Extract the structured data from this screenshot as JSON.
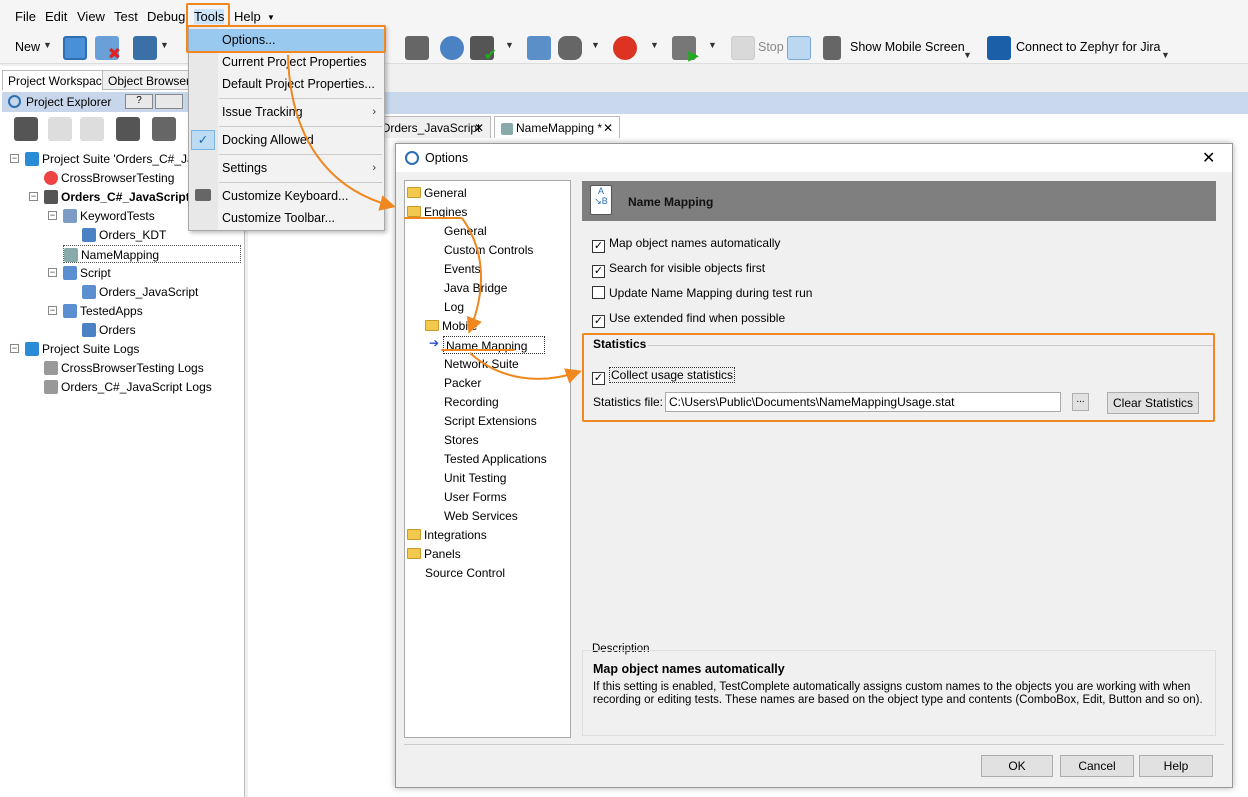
{
  "menubar": {
    "items": [
      "File",
      "Edit",
      "View",
      "Test",
      "Debug",
      "Tools",
      "Help"
    ]
  },
  "toolbar": {
    "new_label": "New",
    "stop_label": "Stop",
    "show_mobile_label": "Show Mobile Screen",
    "connect_label": "Connect to  Zephyr for Jira"
  },
  "left_panel": {
    "tabs": [
      "Project Workspace",
      "Object Browser"
    ],
    "explorer_title": "Project Explorer",
    "tree": [
      "Project Suite 'Orders_C#_Java",
      "CrossBrowserTesting",
      "Orders_C#_JavaScript",
      "KeywordTests",
      "Orders_KDT",
      "NameMapping",
      "Script",
      "Orders_JavaScript",
      "TestedApps",
      "Orders",
      "Project Suite Logs",
      "CrossBrowserTesting Logs",
      "Orders_C#_JavaScript Logs"
    ]
  },
  "doc_tabs": [
    "Orders_JavaScript",
    "NameMapping *"
  ],
  "tools_menu": {
    "items": [
      "Options...",
      "Current Project Properties",
      "Default Project Properties...",
      "Issue Tracking",
      "Docking Allowed",
      "Settings",
      "Customize Keyboard...",
      "Customize Toolbar..."
    ]
  },
  "dialog": {
    "title": "Options",
    "tree": {
      "general": "General",
      "engines": "Engines",
      "engine_children": [
        "General",
        "Custom Controls",
        "Events",
        "Java Bridge",
        "Log",
        "Mobile",
        "Name Mapping",
        "Network Suite",
        "Packer",
        "Recording",
        "Script Extensions",
        "Stores",
        "Tested Applications",
        "Unit Testing",
        "User Forms",
        "Web Services"
      ],
      "integrations": "Integrations",
      "panels": "Panels",
      "source_control": "Source Control"
    },
    "section_title": "Name Mapping",
    "options": [
      {
        "label": "Map object names automatically",
        "checked": true
      },
      {
        "label": "Search for visible objects first",
        "checked": true
      },
      {
        "label": "Update Name Mapping during test run",
        "checked": false
      },
      {
        "label": "Use extended find when possible",
        "checked": true
      }
    ],
    "statistics": {
      "group_label": "Statistics",
      "collect_label": "Collect usage statistics",
      "collect_checked": true,
      "file_label": "Statistics file:",
      "file_value": "C:\\Users\\Public\\Documents\\NameMappingUsage.stat",
      "browse_label": "...",
      "clear_label": "Clear Statistics"
    },
    "description": {
      "group_label": "Description",
      "title": "Map object names automatically",
      "text": "If this setting is enabled, TestComplete automatically assigns custom names to the objects you are working with when recording or editing tests. These names are based on the object type and contents (ComboBox, Edit, Button and so on)."
    },
    "buttons": {
      "ok": "OK",
      "cancel": "Cancel",
      "help": "Help"
    }
  },
  "colors": {
    "highlight": "#f0871f",
    "menu_selection": "#99c9ef",
    "section_header": "#7f7f7f"
  }
}
